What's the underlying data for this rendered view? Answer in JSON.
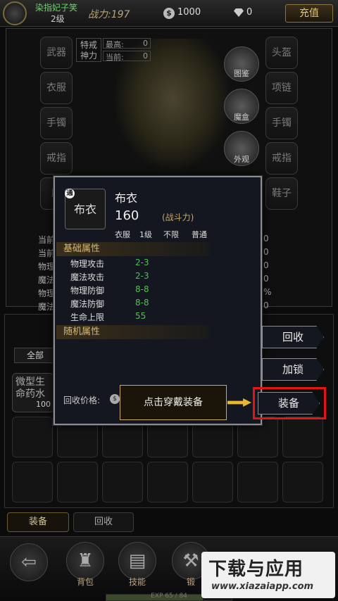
{
  "top": {
    "player_name": "染指妃子笑",
    "level": "2级",
    "power_label": "战力:",
    "power_value": "197",
    "coins": "1000",
    "gems": "0",
    "recharge_label": "充值"
  },
  "equip": {
    "left_slots": [
      "武器",
      "衣服",
      "手镯",
      "戒指",
      "腰"
    ],
    "right_slots": [
      "头盔",
      "项链",
      "手镯",
      "戒指",
      "鞋子"
    ],
    "mid_buttons": [
      "图鉴",
      "魔盒",
      "外观"
    ],
    "divine": "特戒\n神力",
    "max_label": "最高:",
    "max_value": "0",
    "cur_label": "当前:",
    "cur_value": "0",
    "left_stats": [
      "当前",
      "当前",
      "物理",
      "魔法",
      "物理",
      "魔法"
    ],
    "right_stats": [
      "0",
      "0",
      "0",
      "0",
      "%",
      "0"
    ]
  },
  "bag": {
    "tab_all": "全部",
    "item_name": "微型生命药水",
    "item_count": "100"
  },
  "bottom_buttons": {
    "equip": "装备",
    "recycle": "回收"
  },
  "nav": [
    {
      "label": "",
      "icon": "back-arrow-icon"
    },
    {
      "label": "背包",
      "icon": "bag-icon"
    },
    {
      "label": "技能",
      "icon": "book-icon"
    },
    {
      "label": "锻",
      "icon": "forge-icon"
    },
    {
      "label": "",
      "icon": "misc-icon"
    }
  ],
  "exp": {
    "text": "EXP 65 / 84",
    "fraction": 0.77
  },
  "watermark": {
    "title": "下载与应用",
    "url": "www.xiazaiapp.com"
  },
  "tooltip": {
    "quality": "通",
    "icon_text": "布衣",
    "name": "布衣",
    "power": "160",
    "power_label": "(战斗力)",
    "meta": [
      "衣服",
      "1级",
      "不限",
      "普通"
    ],
    "base_header": "基础属性",
    "attrs": [
      {
        "name": "物理攻击",
        "value": "2-3"
      },
      {
        "name": "魔法攻击",
        "value": "2-3"
      },
      {
        "name": "物理防御",
        "value": "8-8"
      },
      {
        "name": "魔法防御",
        "value": "8-8"
      },
      {
        "name": "生命上限",
        "value": "55"
      }
    ],
    "random_header": "随机属性",
    "recycle_price_label": "回收价格:"
  },
  "actions": {
    "recycle": "回收",
    "lock": "加锁",
    "equip": "装备"
  },
  "guide_text": "点击穿戴装备",
  "colors": {
    "highlight": "#e31414",
    "attr_value": "#4ac44a",
    "gold": "#c7a86a"
  }
}
